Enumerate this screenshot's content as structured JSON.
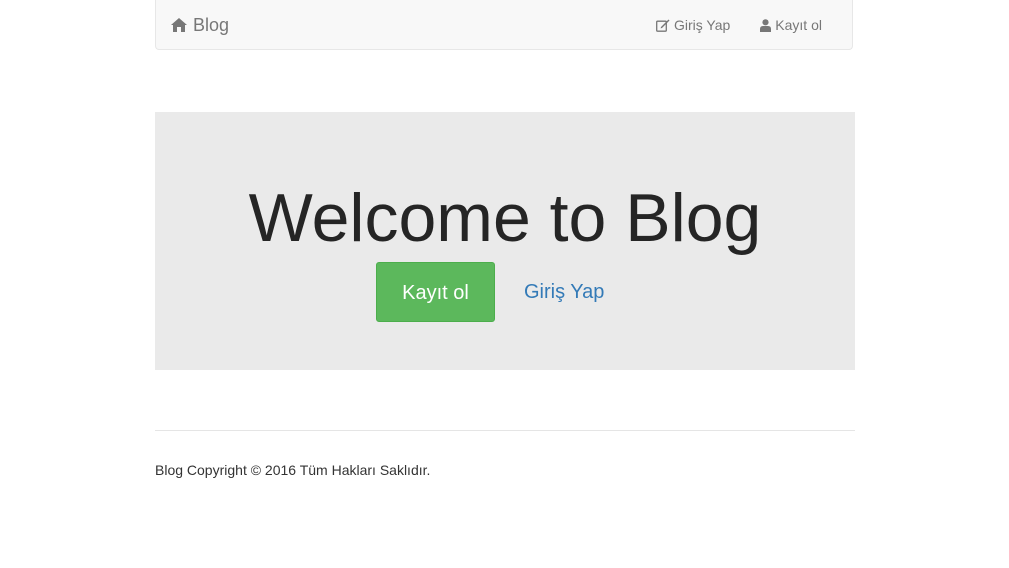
{
  "navbar": {
    "brand": "Blog",
    "brand_icon": "home-icon",
    "links": [
      {
        "label": "Giriş Yap",
        "icon": "edit-icon"
      },
      {
        "label": "Kayıt ol",
        "icon": "user-icon"
      }
    ]
  },
  "jumbotron": {
    "title": "Welcome to Blog",
    "primary_button": "Kayıt ol",
    "secondary_link": "Giriş Yap"
  },
  "footer": {
    "text": "Blog Copyright © 2016 Tüm Hakları Saklıdır."
  },
  "colors": {
    "success": "#5cb85c",
    "link": "#337ab7",
    "jumbotron_bg": "#eaeaea",
    "navbar_bg": "#f8f8f8"
  }
}
